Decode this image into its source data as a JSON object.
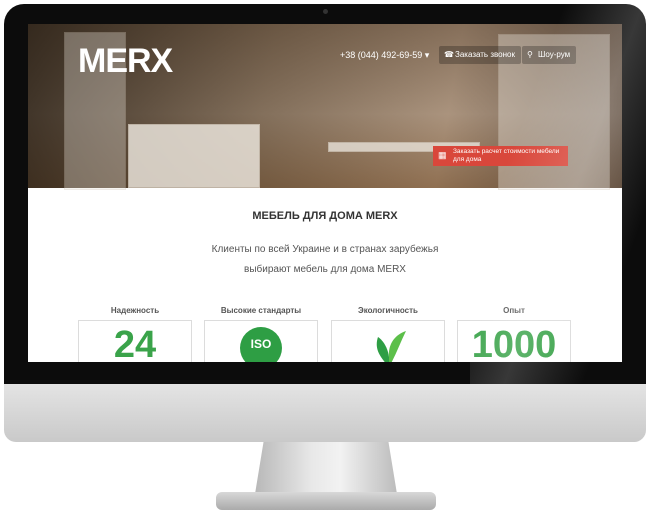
{
  "header": {
    "logo": "MERX",
    "phone": "+38 (044) 492-69-59 ▾",
    "callback_label": "Заказать звонок",
    "showroom_label": "Шоу-рум",
    "cta_label": "Заказать расчет стоимости мебели для дома"
  },
  "main": {
    "title": "МЕБЕЛЬ ДЛЯ ДОМА MERX",
    "subtitle_line1": "Клиенты по всей Украине и в странах зарубежья",
    "subtitle_line2": "выбирают мебель для дома MERX"
  },
  "features": [
    {
      "label": "Надежность",
      "value": "24",
      "icon": "number"
    },
    {
      "label": "Высокие стандарты",
      "value": "ISO",
      "icon": "iso-badge-icon"
    },
    {
      "label": "Экологичность",
      "value": "",
      "icon": "leaf-icon"
    },
    {
      "label": "Опыт",
      "value": "1000",
      "icon": "number"
    }
  ],
  "colors": {
    "accent_red": "#d9473b",
    "accent_green": "#3aa34a"
  }
}
